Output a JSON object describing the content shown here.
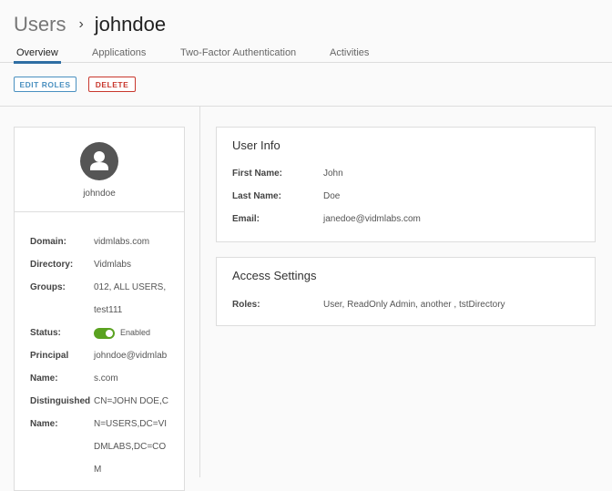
{
  "breadcrumb": {
    "parent": "Users",
    "separator": "›",
    "current": "johndoe"
  },
  "tabs": [
    {
      "label": "Overview",
      "active": true
    },
    {
      "label": "Applications"
    },
    {
      "label": "Two-Factor Authentication"
    },
    {
      "label": "Activities"
    }
  ],
  "toolbar": {
    "edit_roles": "EDIT ROLES",
    "delete": "DELETE"
  },
  "colors": {
    "accent": "#2f6ea3",
    "edit": "#4a90c0",
    "delete": "#c8372d",
    "toggle": "#5aa220"
  },
  "profile": {
    "avatar_icon": "user-icon",
    "username": "johndoe",
    "fields": {
      "domain": {
        "label": "Domain:",
        "value": "vidmlabs.com"
      },
      "directory": {
        "label": "Directory:",
        "value": "Vidmlabs"
      },
      "groups": {
        "label": "Groups:",
        "value": "012, ALL USERS, test111"
      },
      "status": {
        "label": "Status:",
        "value": "Enabled",
        "enabled": true
      },
      "principal": {
        "label": "Principal Name:",
        "value": "johndoe@vidmlabs.com"
      },
      "dn": {
        "label": "Distinguished Name:",
        "value": "CN=JOHN DOE,CN=USERS,DC=VIDMLABS,DC=COM"
      }
    }
  },
  "user_info": {
    "title": "User Info",
    "first_name": {
      "label": "First Name:",
      "value": "John"
    },
    "last_name": {
      "label": "Last Name:",
      "value": "Doe"
    },
    "email": {
      "label": "Email:",
      "value": "janedoe@vidmlabs.com"
    }
  },
  "access": {
    "title": "Access Settings",
    "roles": {
      "label": "Roles:",
      "value": "User, ReadOnly Admin, another , tstDirectory"
    }
  }
}
